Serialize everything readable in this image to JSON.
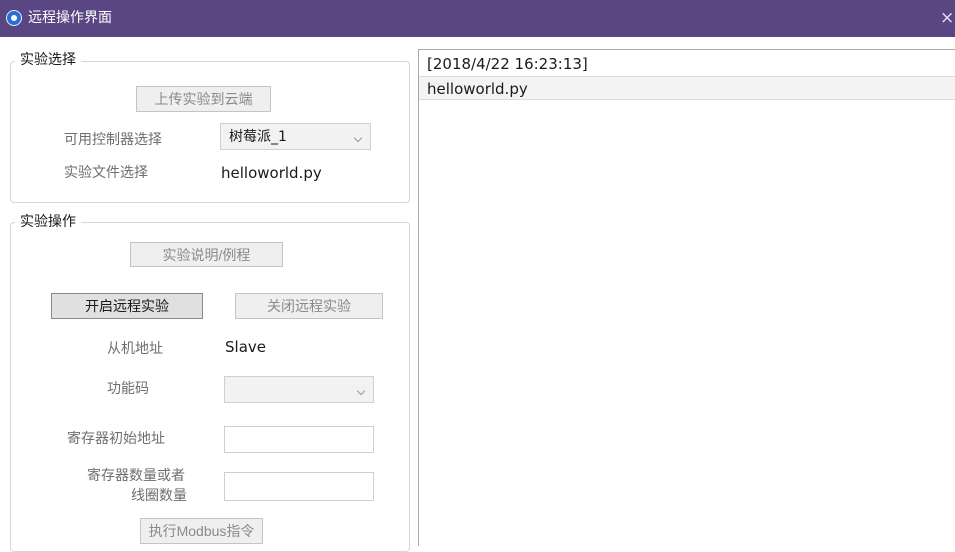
{
  "window": {
    "title": "远程操作界面",
    "close_glyph": "×"
  },
  "experiment_select": {
    "group_title": "实验选择",
    "upload_button": "上传实验到云端",
    "controller_label": "可用控制器选择",
    "controller_value": "树莓派_1",
    "file_label": "实验文件选择",
    "file_value": "helloworld.py"
  },
  "experiment_ops": {
    "group_title": "实验操作",
    "guide_button": "实验说明/例程",
    "start_button": "开启远程实验",
    "stop_button": "关闭远程实验",
    "slave_label": "从机地址",
    "slave_value": "Slave",
    "function_code_label": "功能码",
    "function_code_value": "",
    "register_start_label": "寄存器初始地址",
    "register_start_value": "",
    "register_count_label_line1": "寄存器数量或者",
    "register_count_label_line2": "线圈数量",
    "register_count_value": "",
    "execute_button": "执行Modbus指令"
  },
  "log": {
    "entries": [
      "[2018/4/22 16:23:13]",
      "helloworld.py"
    ]
  }
}
